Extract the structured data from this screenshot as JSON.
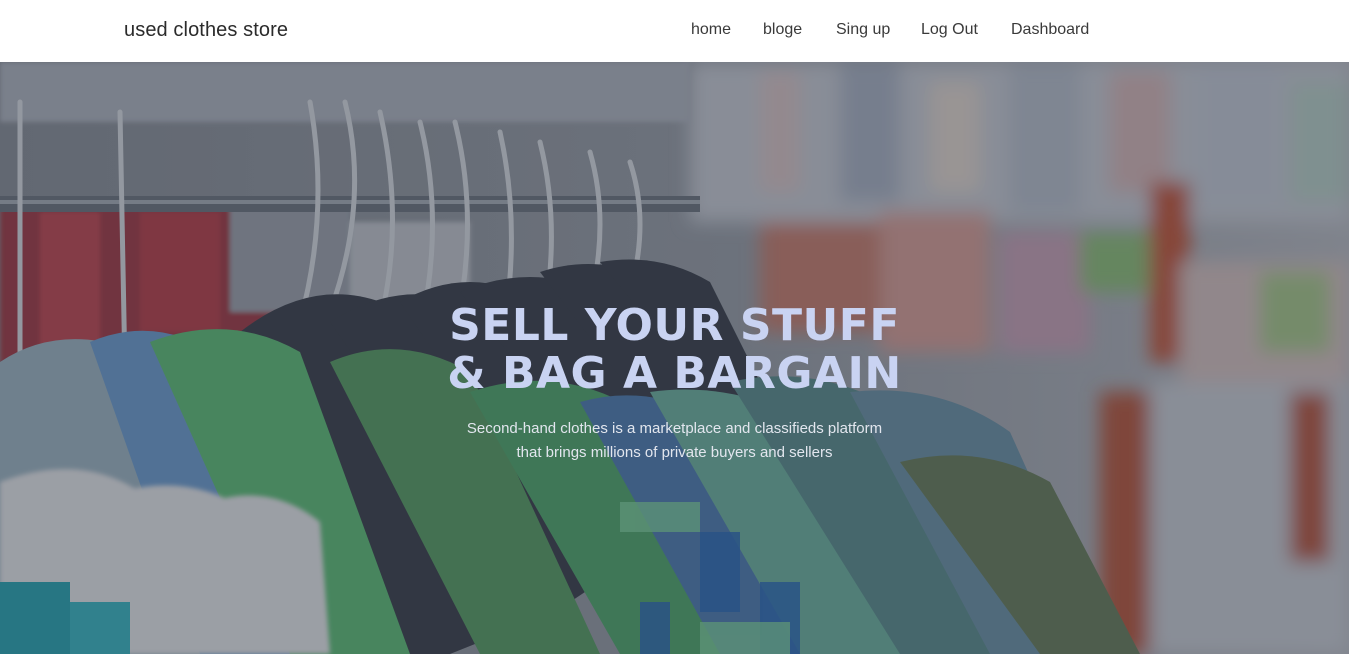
{
  "navbar": {
    "brand": "used clothes store",
    "links": [
      {
        "label": "home"
      },
      {
        "label": "bloge"
      },
      {
        "label": "Sing up"
      },
      {
        "label": "Log Out"
      },
      {
        "label": "Dashboard"
      }
    ]
  },
  "hero": {
    "title_line1": "SELL YOUR STUFF",
    "title_line2": "& BAG A BARGAIN",
    "subtitle_line1": "Second-hand clothes is a marketplace and classifieds platform",
    "subtitle_line2": "that brings millions of private buyers and sellers",
    "background_image": "clothes-on-hangers-photo",
    "colors": {
      "title": "#c9d3f2",
      "subtitle": "#e2e6ee",
      "overlay": "#232834"
    }
  }
}
